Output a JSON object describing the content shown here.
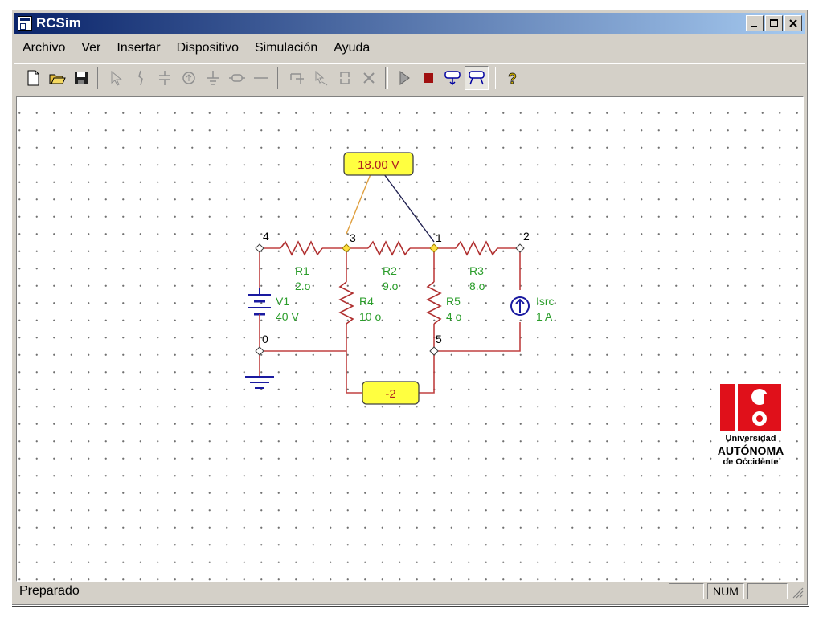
{
  "window": {
    "title": "RCSim"
  },
  "menu": {
    "items": [
      "Archivo",
      "Ver",
      "Insertar",
      "Dispositivo",
      "Simulación",
      "Ayuda"
    ]
  },
  "toolbar": {
    "icons": [
      "new-file-icon",
      "open-folder-icon",
      "save-icon",
      "select-pointer-icon",
      "wire-icon",
      "capacitor-icon",
      "current-source-icon",
      "ground-icon",
      "resistor-icon",
      "line-icon",
      "rotate-icon",
      "move-icon",
      "flip-icon",
      "delete-icon",
      "run-icon",
      "stop-icon",
      "voltmeter-icon",
      "ammeter-icon",
      "help-icon"
    ]
  },
  "circuit": {
    "voltmeter_reading": "18.00 V",
    "ammeter_reading": "-2",
    "nodes": {
      "n4": "4",
      "n3": "3",
      "n1": "1",
      "n2": "2",
      "n0": "0",
      "n5": "5"
    },
    "components": {
      "r1": {
        "name": "R1",
        "value": "2.o"
      },
      "r2": {
        "name": "R2",
        "value": "9.o"
      },
      "r3": {
        "name": "R3",
        "value": "8.o"
      },
      "r4": {
        "name": "R4",
        "value": "10 o"
      },
      "r5": {
        "name": "R5",
        "value": "4 o"
      },
      "v1": {
        "name": "V1",
        "value": "40 V"
      },
      "isrc": {
        "name": "Isrc",
        "value": "1 A"
      }
    },
    "colors": {
      "wire": "#c04040",
      "resistor": "#b03030",
      "label": "#2a9d2a",
      "meter_fill": "#ffff40",
      "battery": "#1a1aa0"
    }
  },
  "logo": {
    "line1": "Universidad",
    "line2": "AUTÓNOMA",
    "line3": "de Occidente",
    "color": "#e0101a"
  },
  "status": {
    "text": "Preparado",
    "num": "NUM"
  }
}
